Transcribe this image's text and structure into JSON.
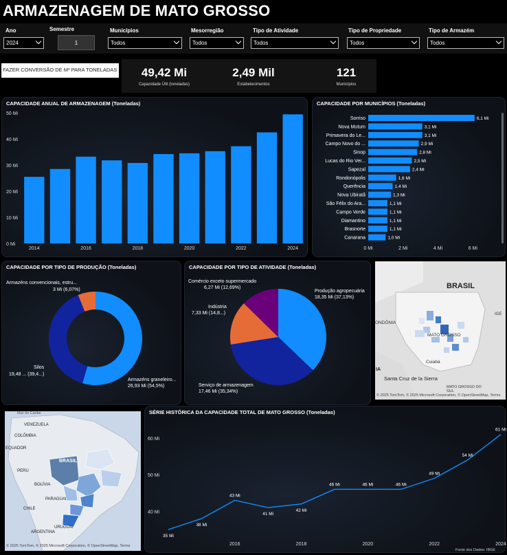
{
  "title": "ARMAZENAGEM DE MATO GROSSO",
  "filters": {
    "ano": {
      "label": "Ano",
      "value": "2024"
    },
    "semestre": {
      "label": "Semestre",
      "value": "1"
    },
    "municipios": {
      "label": "Municípios",
      "value": "Todos"
    },
    "mesorregiao": {
      "label": "Mesorregião",
      "value": "Todos"
    },
    "tipo_atividade": {
      "label": "Tipo de Atividade",
      "value": "Todos"
    },
    "tipo_propriedade": {
      "label": "Tipo de Propriedade",
      "value": "Todos"
    },
    "tipo_armazem": {
      "label": "Tipo de Armazém",
      "value": "Todos"
    }
  },
  "conversion_button": "FAZER CONVERSÃO DE M³ PARA TONELADAS",
  "kpis": [
    {
      "value": "49,42 Mi",
      "label": "Capacidade Útil (toneladas)"
    },
    {
      "value": "2,49 Mil",
      "label": "Estabelecimentos"
    },
    {
      "value": "121",
      "label": "Municípios"
    }
  ],
  "colors": {
    "bar_blue": "#118dff",
    "dark_blue": "#12239e",
    "orange": "#e66c37",
    "purple": "#6b007b",
    "line_blue": "#118dff"
  },
  "annual_chart": {
    "title": "CAPACIDADE ANUAL DE ARMAZENAGEM (Toneladas)",
    "chart_data": {
      "type": "bar",
      "categories": [
        "2014",
        "2015",
        "2016",
        "2017",
        "2018",
        "2019",
        "2020",
        "2021",
        "2022",
        "2023",
        "2024"
      ],
      "values": [
        25.5,
        28.5,
        33.2,
        31.8,
        30.8,
        34.2,
        34.5,
        35.3,
        37.2,
        42.5,
        49.4
      ],
      "x_tick_labels": [
        "2014",
        "2016",
        "2018",
        "2020",
        "2022",
        "2024"
      ],
      "y_ticks": [
        "0 Mi",
        "10 Mi",
        "20 Mi",
        "30 Mi",
        "40 Mi",
        "50 Mi"
      ],
      "ylim": [
        0,
        50
      ]
    }
  },
  "municipios_chart": {
    "title": "CAPACIDADE POR MUNICÍPIOS (Toneladas)",
    "chart_data": {
      "type": "bar",
      "orientation": "horizontal",
      "categories": [
        "Sorriso",
        "Nova Mutum",
        "Primavera do Le...",
        "Campo Novo do ...",
        "Sinop",
        "Lucas do Rio Ver...",
        "Sapezal",
        "Rondonópolis",
        "Querência",
        "Nova Ubiratã",
        "São Félix do Ara...",
        "Campo Verde",
        "Diamantino",
        "Brasnorte",
        "Canarana"
      ],
      "values": [
        6.1,
        3.1,
        3.1,
        2.9,
        2.8,
        2.5,
        2.4,
        1.6,
        1.4,
        1.3,
        1.1,
        1.1,
        1.1,
        1.1,
        1.0
      ],
      "value_labels": [
        "6,1 Mi",
        "3,1 Mi",
        "3,1 Mi",
        "2,9 Mi",
        "2,8 Mi",
        "2,5 Mi",
        "2,4 Mi",
        "1,6 Mi",
        "1,4 Mi",
        "1,3 Mi",
        "1,1 Mi",
        "1,1 Mi",
        "1,1 Mi",
        "1,1 Mi",
        "1,0 Mi"
      ],
      "x_ticks": [
        "0 Mi",
        "2 Mi",
        "4 Mi",
        "6 Mi"
      ],
      "xlim": [
        0,
        6.5
      ]
    }
  },
  "producao_chart": {
    "title": "CAPACIDADE POR TIPO DE PRODUÇÃO (Toneladas)",
    "chart_data": {
      "type": "pie",
      "variant": "donut",
      "labels": [
        "Armazéns graneleiro...",
        "Silos",
        "Armazéns convencionais, estru..."
      ],
      "values": [
        26.93,
        19.48,
        3.0
      ],
      "value_labels": [
        "26,93 Mi (54,5%)",
        "19,48 ... (39,4...)",
        "3 Mi (6,07%)"
      ]
    }
  },
  "atividade_chart": {
    "title": "CAPACIDADE POR TIPO DE ATIVIDADE (Toneladas)",
    "chart_data": {
      "type": "pie",
      "labels": [
        "Produção agropecuária",
        "Serviço de armazenagem",
        "Indústria",
        "Comércio exceto supermercado"
      ],
      "values": [
        18.35,
        17.46,
        7.33,
        6.27
      ],
      "value_labels": [
        "18,35 Mi (37,13%)",
        "17,46 Mi (35,34%)",
        "7,33 Mi (14,8...)",
        "6,27 Mi (12,69%)"
      ]
    }
  },
  "map_mt": {
    "labels": {
      "country": "BRASIL",
      "state": "MATO GROSSO",
      "city": "Cuiabá",
      "city2": "Santa Cruz de la Sierra",
      "state2": "MATO GROSSO DO SUL",
      "left": "ONDÔNIA",
      "bolivia_frag": "IA",
      "right": "IGE"
    },
    "attribution": "© 2025 TomTom, © 2025 Microsoft Corporation, © OpenStreetMap, Terms"
  },
  "map_sa": {
    "labels": {
      "sea": "Mar do Caribe",
      "venezuela": "VENEZUELA",
      "colombia": "COLÔMBIA",
      "equador": "EQUADOR",
      "peru": "PERU",
      "brasil": "BRASIL",
      "bolivia": "BOLÍVIA",
      "paraguai": "PARAGUAI",
      "chile": "CHILE",
      "uruguai": "URUGUAI",
      "argentina": "ARGENTINA"
    },
    "attribution": "© 2025 TomTom, © 2025 Microsoft Corporation, © OpenStreetMap, Terms"
  },
  "serie_chart": {
    "title": "SÉRIE HISTÓRICA DA CAPACIDADE TOTAL DE MATO GROSSO (Toneladas)",
    "chart_data": {
      "type": "line",
      "x": [
        2014,
        2015,
        2016,
        2017,
        2018,
        2019,
        2020,
        2021,
        2022,
        2023,
        2024
      ],
      "values": [
        35,
        38,
        43,
        41,
        42,
        46,
        46,
        46,
        49,
        54,
        61
      ],
      "value_labels": [
        "35 Mi",
        "38 Mi",
        "43 Mi",
        "41 Mi",
        "42 Mi",
        "46 Mi",
        "46 Mi",
        "46 Mi",
        "49 Mi",
        "54 Mi",
        "61 Mi"
      ],
      "x_ticks": [
        "2016",
        "2018",
        "2020",
        "2022",
        "2024"
      ],
      "y_ticks": [
        "40 Mi",
        "50 Mi",
        "60 Mi"
      ],
      "ylim": [
        32,
        63
      ]
    }
  },
  "source_note": "Fonte dos Dados: IBGE"
}
